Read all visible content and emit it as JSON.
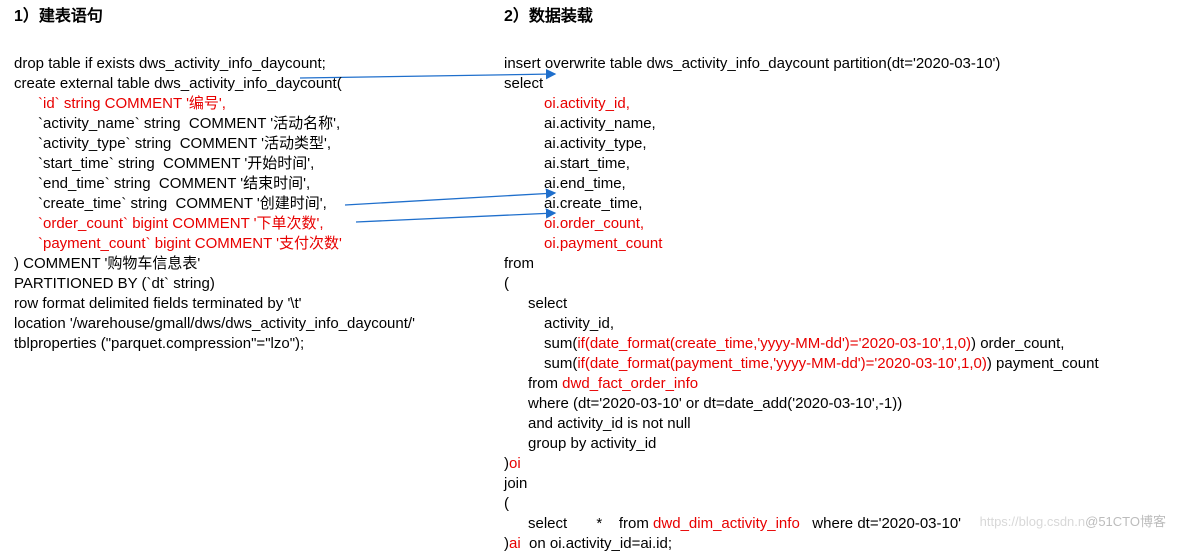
{
  "left": {
    "title": "1）建表语句",
    "l1": "drop table if exists dws_activity_info_daycount;",
    "l2": "create external table dws_activity_info_daycount(",
    "l3": "`id` string COMMENT '编号',",
    "l4": "`activity_name` string  COMMENT '活动名称',",
    "l5": "`activity_type` string  COMMENT '活动类型',",
    "l6": "`start_time` string  COMMENT '开始时间',",
    "l7": "`end_time` string  COMMENT '结束时间',",
    "l8": "`create_time` string  COMMENT '创建时间',",
    "l9": "`order_count` bigint COMMENT '下单次数',",
    "l10": "`payment_count` bigint COMMENT '支付次数'",
    "l11": ") COMMENT '购物车信息表'",
    "l12": "PARTITIONED BY (`dt` string)",
    "l13": "row format delimited fields terminated by '\\t'",
    "l14": "location '/warehouse/gmall/dws/dws_activity_info_daycount/'",
    "l15": "tblproperties (\"parquet.compression\"=\"lzo\");"
  },
  "right": {
    "title": "2）数据装载",
    "r1": "insert overwrite table dws_activity_info_daycount partition(dt='2020-03-10')",
    "r2": "select",
    "r3": "oi.activity_id,",
    "r4": "ai.activity_name,",
    "r5": "ai.activity_type,",
    "r6": "ai.start_time,",
    "r7": "ai.end_time,",
    "r8": "ai.create_time,",
    "r9": "oi.order_count,",
    "r10": "oi.payment_count",
    "r11": "from",
    "r12": "(",
    "r13": "select",
    "r14": "activity_id,",
    "r15a": "sum(",
    "r15b": "if(date_format(create_time,'yyyy-MM-dd')='2020-03-10',1,0)",
    "r15c": ") order_count,",
    "r16a": "sum(",
    "r16b": "if(date_format(payment_time,'yyyy-MM-dd')='2020-03-10',1,0)",
    "r16c": ") payment_count",
    "r17a": "from ",
    "r17b": "dwd_fact_order_info",
    "r18": "where (dt='2020-03-10' or dt=date_add('2020-03-10',-1))",
    "r19": "and activity_id is not null",
    "r20": "group by activity_id",
    "r21a": ")",
    "r21b": "oi",
    "r22": "join",
    "r23": "(",
    "r24a": "select       *    from ",
    "r24b": "dwd_dim_activity_info",
    "r24c": "   where dt='2020-03-10'",
    "r25a": ")",
    "r25b": "ai",
    "r25c": "  on oi.activity_id=ai.id;"
  },
  "watermark": {
    "a": "https://blog.csdn.n",
    "b": "@51CTO博客"
  }
}
